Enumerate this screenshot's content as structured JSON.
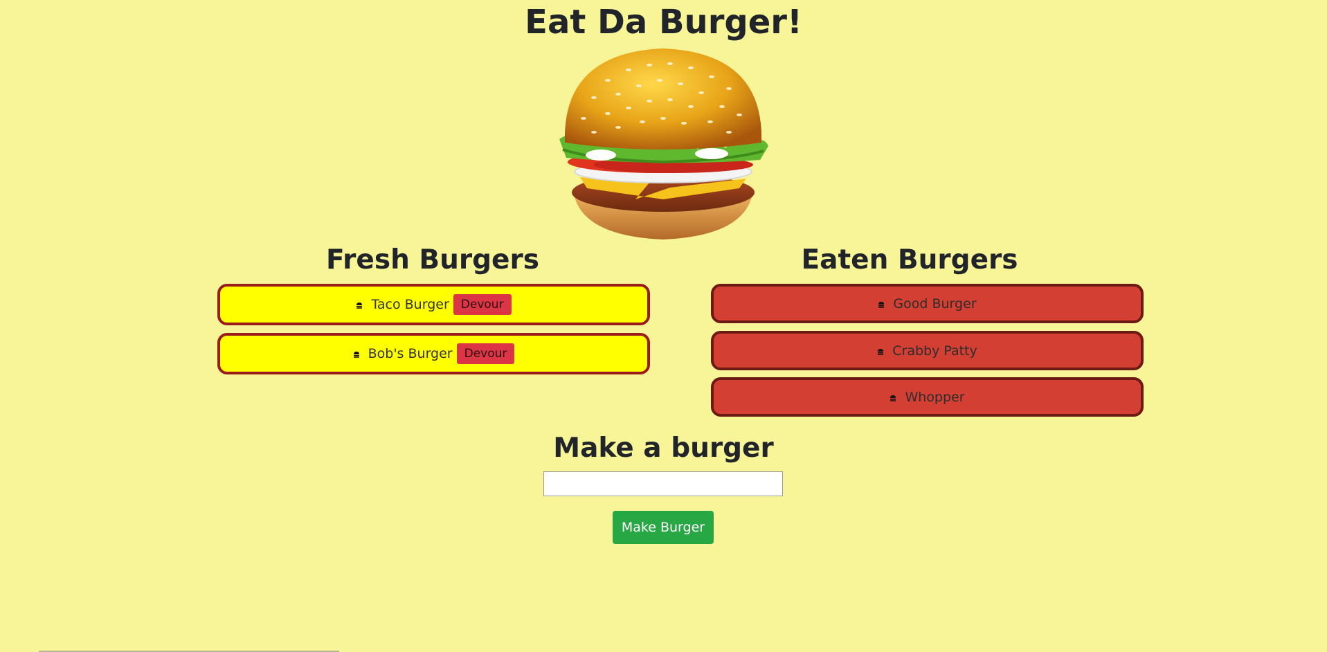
{
  "header": {
    "title": "Eat Da Burger!"
  },
  "fresh": {
    "title": "Fresh Burgers",
    "items": [
      {
        "name": "Taco Burger",
        "button_label": "Devour"
      },
      {
        "name": "Bob's Burger",
        "button_label": "Devour"
      }
    ]
  },
  "eaten": {
    "title": "Eaten Burgers",
    "items": [
      {
        "name": "Good Burger"
      },
      {
        "name": "Crabby Patty"
      },
      {
        "name": "Whopper"
      }
    ]
  },
  "make": {
    "title": "Make a burger",
    "input_value": "",
    "input_placeholder": "",
    "button_label": "Make Burger"
  },
  "colors": {
    "background": "#f8f598",
    "fresh_card": "#ffff00",
    "eaten_card": "#d43f33",
    "devour_button": "#dc3545",
    "make_button": "#28a745"
  },
  "icons": {
    "hero": "burger-image",
    "list_item": "burger-icon"
  }
}
